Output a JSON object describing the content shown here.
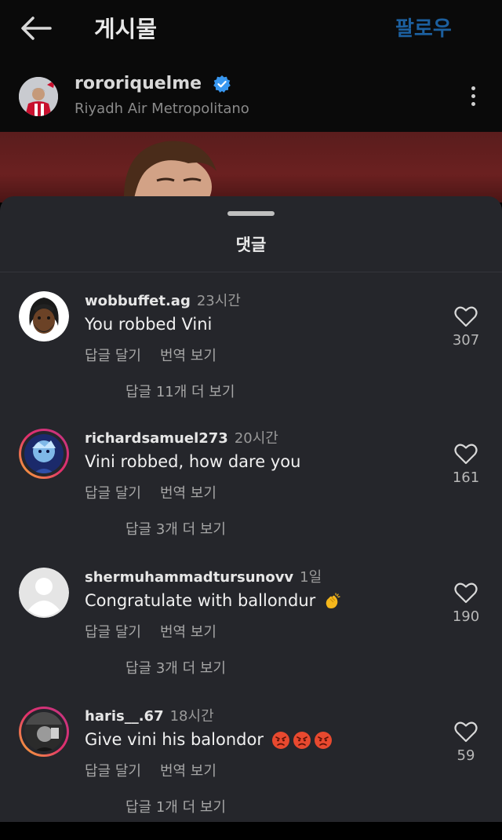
{
  "header": {
    "title": "게시물",
    "follow_label": "팔로우"
  },
  "post": {
    "username": "rororiquelme",
    "location": "Riyadh Air Metropolitano"
  },
  "sheet": {
    "title": "댓글"
  },
  "labels": {
    "reply": "답글 달기",
    "translate": "번역 보기"
  },
  "comments": [
    {
      "username": "wobbuffet.ag",
      "time": "23시간",
      "text": "You robbed Vini",
      "likes": "307",
      "more_replies": "답글 11개 더 보기"
    },
    {
      "username": "richardsamuel273",
      "time": "20시간",
      "text": "Vini robbed, how dare you",
      "likes": "161",
      "more_replies": "답글 3개 더 보기"
    },
    {
      "username": "shermuhammadtursunovv",
      "time": "1일",
      "text": "Congratulate with ballondur",
      "likes": "190",
      "more_replies": "답글 3개 더 보기"
    },
    {
      "username": "haris__.67",
      "time": "18시간",
      "text": "Give vini his balondor",
      "likes": "59",
      "more_replies": "답글 1개 더 보기"
    }
  ],
  "colors": {
    "follow": "#1c5f9e",
    "sheet_bg": "#25262b",
    "verified": "#3897f0"
  }
}
